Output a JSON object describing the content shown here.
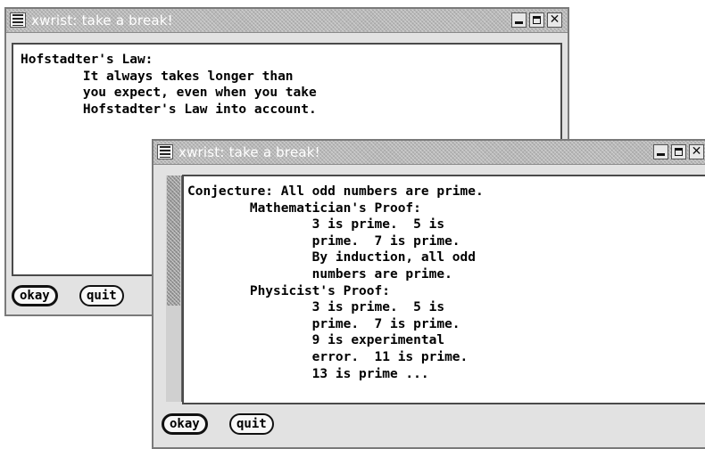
{
  "window_1": {
    "title": "xwrist: take a break!",
    "close_glyph": "✕",
    "lines": [
      "Hofstadter's Law:",
      "        It always takes longer than",
      "        you expect, even when you take",
      "        Hofstadter's Law into account."
    ],
    "okay_label": "okay",
    "quit_label": "quit"
  },
  "window_2": {
    "title": "xwrist: take a break!",
    "close_glyph": "✕",
    "lines": [
      "Conjecture: All odd numbers are prime.",
      "        Mathematician's Proof:",
      "                3 is prime.  5 is",
      "                prime.  7 is prime.",
      "                By induction, all odd",
      "                numbers are prime.",
      "        Physicist's Proof:",
      "                3 is prime.  5 is",
      "                prime.  7 is prime.",
      "                9 is experimental",
      "                error.  11 is prime.",
      "                13 is prime ..."
    ],
    "okay_label": "okay",
    "quit_label": "quit"
  },
  "icons": {
    "window_menu": "window-menu-icon",
    "minimize": "minimize-icon",
    "maximize": "maximize-icon",
    "close": "close-icon"
  },
  "colors": {
    "titlebar": "#b8b8b8",
    "window_bg": "#e2e2e2",
    "text_bg": "#ffffff",
    "text": "#000000"
  }
}
